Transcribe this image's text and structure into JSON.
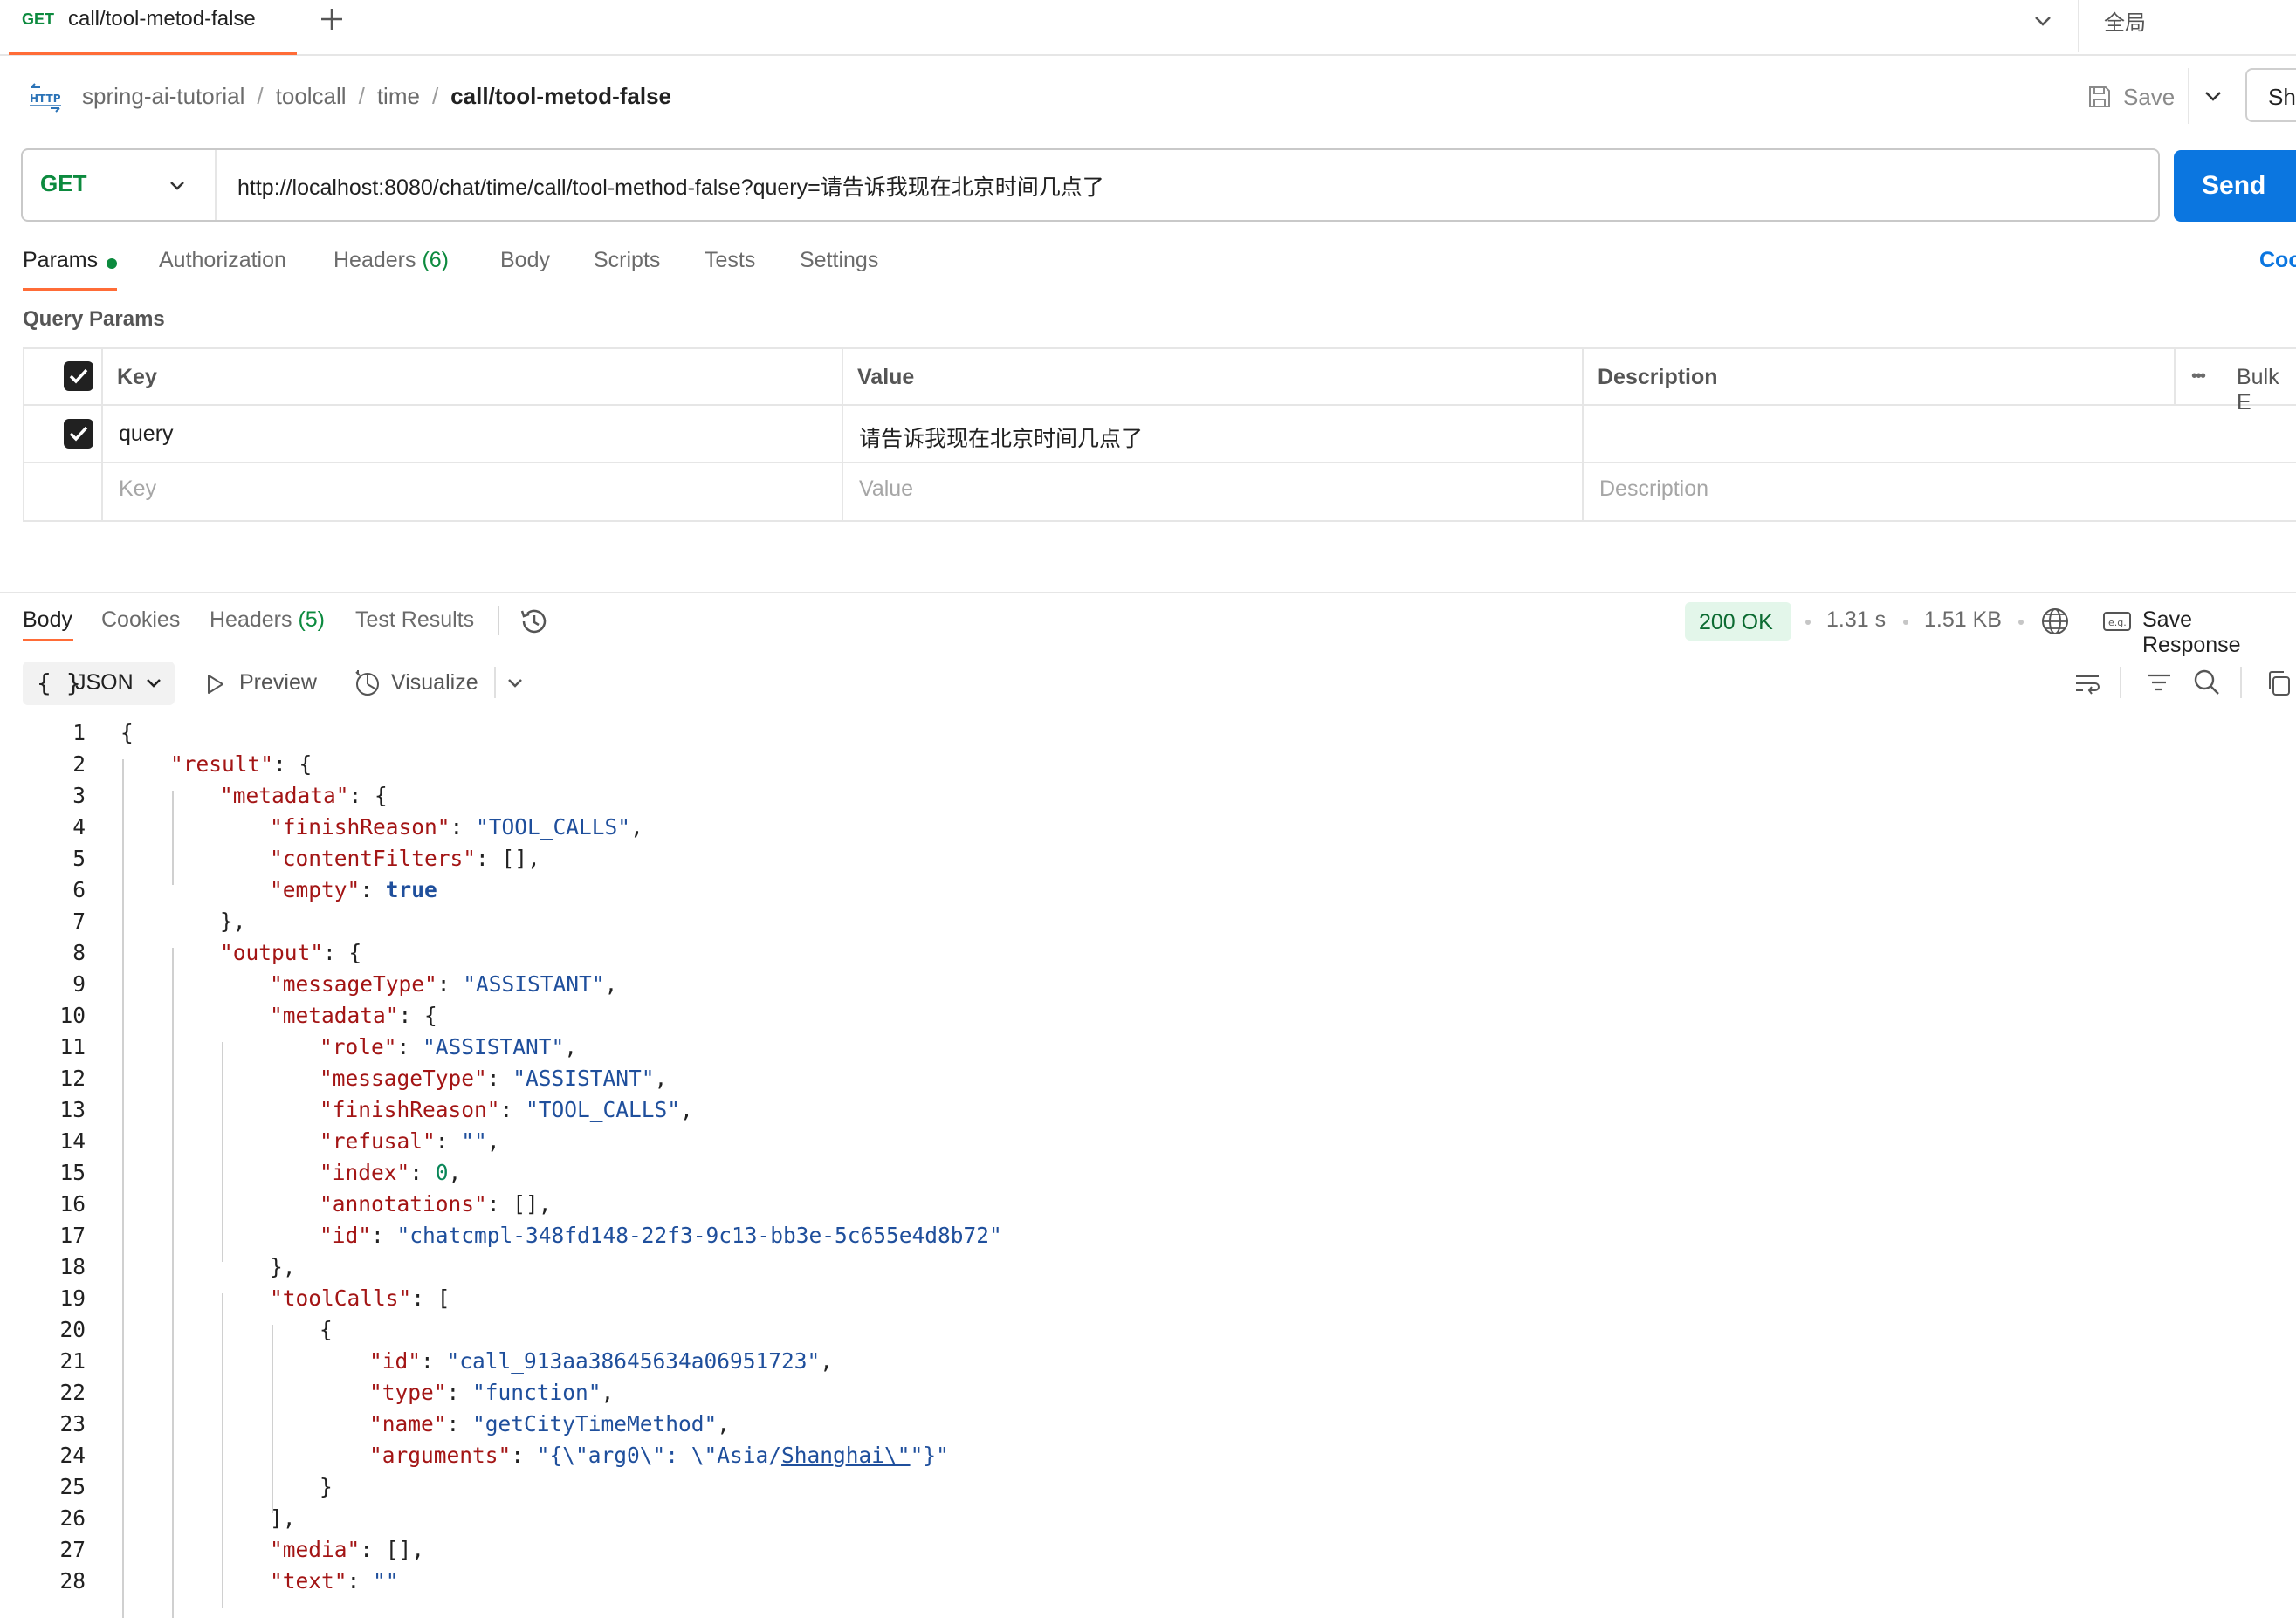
{
  "tab": {
    "method": "GET",
    "title": "call/tool-metod-false",
    "environment": "全局"
  },
  "breadcrumb": {
    "items": [
      "spring-ai-tutorial",
      "toolcall",
      "time"
    ],
    "separator": "/",
    "current": "call/tool-metod-false"
  },
  "actions": {
    "save": "Save",
    "share": "Sh"
  },
  "request": {
    "method": "GET",
    "url": "http://localhost:8080/chat/time/call/tool-method-false?query=请告诉我现在北京时间几点了",
    "send": "Send"
  },
  "request_tabs": {
    "params": "Params",
    "authorization": "Authorization",
    "headers": "Headers",
    "headers_count": "(6)",
    "body": "Body",
    "scripts": "Scripts",
    "tests": "Tests",
    "settings": "Settings",
    "code": "Coo"
  },
  "query_params": {
    "title": "Query Params",
    "headers": {
      "key": "Key",
      "value": "Value",
      "description": "Description",
      "bulk_edit": "Bulk E"
    },
    "rows": [
      {
        "checked": true,
        "key": "query",
        "value": "请告诉我现在北京时间几点了",
        "description": ""
      }
    ],
    "placeholder": {
      "key": "Key",
      "value": "Value",
      "description": "Description"
    }
  },
  "response_tabs": {
    "body": "Body",
    "cookies": "Cookies",
    "headers": "Headers",
    "headers_count": "(5)",
    "test_results": "Test Results"
  },
  "response_meta": {
    "status": "200 OK",
    "time": "1.31 s",
    "size": "1.51 KB",
    "save_response": "Save Response"
  },
  "toolbar": {
    "format_braces": "{ }",
    "format": "JSON",
    "preview": "Preview",
    "visualize": "Visualize"
  },
  "colors": {
    "accent_orange": "#ff6c37",
    "send_blue": "#0b76e0",
    "get_green": "#0c8a3e",
    "json_key": "#a31515",
    "json_string": "#1f4f9c"
  },
  "code": {
    "l1": "{",
    "l2": [
      "\"result\"",
      ": {"
    ],
    "l3": [
      "\"metadata\"",
      ": {"
    ],
    "l4": [
      "\"finishReason\"",
      ": ",
      "\"TOOL_CALLS\"",
      ","
    ],
    "l5": [
      "\"contentFilters\"",
      ": [],"
    ],
    "l6": [
      "\"empty\"",
      ": ",
      "true"
    ],
    "l7": "},",
    "l8": [
      "\"output\"",
      ": {"
    ],
    "l9": [
      "\"messageType\"",
      ": ",
      "\"ASSISTANT\"",
      ","
    ],
    "l10": [
      "\"metadata\"",
      ": {"
    ],
    "l11": [
      "\"role\"",
      ": ",
      "\"ASSISTANT\"",
      ","
    ],
    "l12": [
      "\"messageType\"",
      ": ",
      "\"ASSISTANT\"",
      ","
    ],
    "l13": [
      "\"finishReason\"",
      ": ",
      "\"TOOL_CALLS\"",
      ","
    ],
    "l14": [
      "\"refusal\"",
      ": ",
      "\"\"",
      ","
    ],
    "l15": [
      "\"index\"",
      ": ",
      "0",
      ","
    ],
    "l16": [
      "\"annotations\"",
      ": [],"
    ],
    "l17": [
      "\"id\"",
      ": ",
      "\"chatcmpl-348fd148-22f3-9c13-bb3e-5c655e4d8b72\""
    ],
    "l18": "},",
    "l19": [
      "\"toolCalls\"",
      ": ["
    ],
    "l20": "{",
    "l21": [
      "\"id\"",
      ": ",
      "\"call_913aa38645634a06951723\"",
      ","
    ],
    "l22": [
      "\"type\"",
      ": ",
      "\"function\"",
      ","
    ],
    "l23": [
      "\"name\"",
      ": ",
      "\"getCityTimeMethod\"",
      ","
    ],
    "l24": [
      "\"arguments\"",
      ": ",
      "\"{\\\"arg0\\\": \\\"Asia/",
      "Shanghai\\\"",
      "\"}\""
    ],
    "l25": "}",
    "l26": "],",
    "l27": [
      "\"media\"",
      ": [],"
    ],
    "l28": [
      "\"text\"",
      ": ",
      "\"\""
    ]
  },
  "line_numbers": [
    "1",
    "2",
    "3",
    "4",
    "5",
    "6",
    "7",
    "8",
    "9",
    "10",
    "11",
    "12",
    "13",
    "14",
    "15",
    "16",
    "17",
    "18",
    "19",
    "20",
    "21",
    "22",
    "23",
    "24",
    "25",
    "26",
    "27",
    "28"
  ]
}
